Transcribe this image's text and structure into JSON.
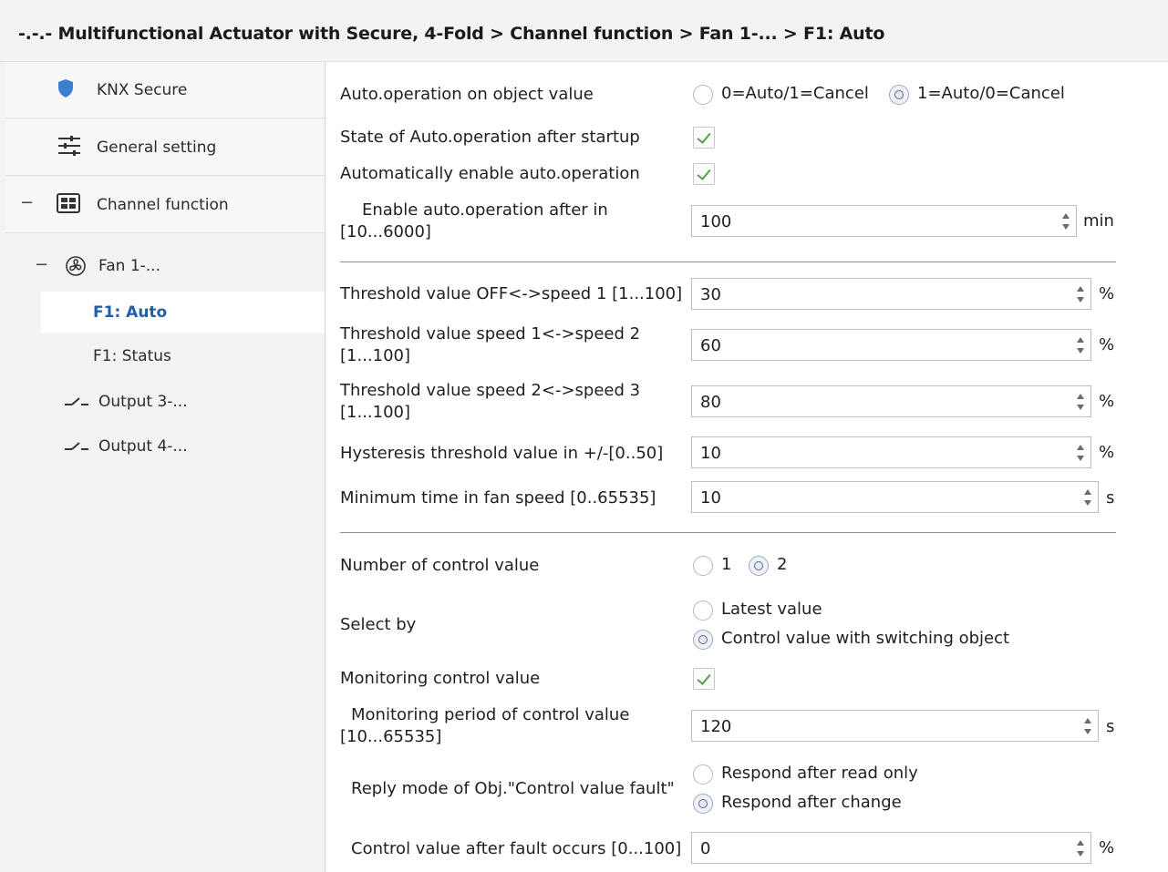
{
  "header": {
    "breadcrumb": "-.-.- Multifunctional Actuator with Secure, 4-Fold > Channel function > Fan 1-... > F1: Auto"
  },
  "sidebar": {
    "knx_secure": "KNX Secure",
    "general_setting": "General setting",
    "channel_function": "Channel function",
    "fan": "Fan 1-...",
    "f1_auto": "F1: Auto",
    "f1_status": "F1: Status",
    "output3": "Output 3-...",
    "output4": "Output 4-...",
    "collapse_glyph": "−",
    "accent_color": "#1f5faa"
  },
  "params": {
    "auto_operation": {
      "label": "Auto.operation on object value",
      "opt1": "0=Auto/1=Cancel",
      "opt2": "1=Auto/0=Cancel",
      "selected": "opt2"
    },
    "state_after_startup": {
      "label": "State of Auto.operation after startup",
      "checked": true
    },
    "auto_enable": {
      "label": "Automatically enable auto.operation",
      "checked": true
    },
    "enable_after": {
      "label1": "Enable auto.operation after in",
      "label2": "[10...6000]",
      "value": "100",
      "unit": "min"
    },
    "th_off_speed1": {
      "label": "Threshold value OFF<->speed 1 [1...100]",
      "value": "30",
      "unit": "%"
    },
    "th_speed1_2": {
      "label1": "Threshold value speed 1<->speed 2",
      "label2": "[1...100]",
      "value": "60",
      "unit": "%"
    },
    "th_speed2_3": {
      "label1": "Threshold value speed 2<->speed 3",
      "label2": "[1...100]",
      "value": "80",
      "unit": "%"
    },
    "hysteresis": {
      "label": "Hysteresis threshold value in +/-[0..50]",
      "value": "10",
      "unit": "%"
    },
    "min_time": {
      "label": "Minimum time in fan speed [0..65535]",
      "value": "10",
      "unit": "s"
    },
    "num_control": {
      "label": "Number of control value",
      "opt1": "1",
      "opt2": "2",
      "selected": "opt2"
    },
    "select_by": {
      "label": "Select by",
      "opt1": "Latest value",
      "opt2": "Control value with switching object",
      "selected": "opt2"
    },
    "monitoring": {
      "label": "Monitoring control value",
      "checked": true
    },
    "monitor_period": {
      "label1": "Monitoring period of control value",
      "label2": "[10...65535]",
      "value": "120",
      "unit": "s"
    },
    "reply_mode": {
      "label": "Reply mode of Obj.\"Control value fault\"",
      "opt1": "Respond after read only",
      "opt2": "Respond after change",
      "selected": "opt2"
    },
    "fault_value": {
      "label": "Control value after fault occurs [0...100]",
      "value": "0",
      "unit": "%"
    }
  }
}
